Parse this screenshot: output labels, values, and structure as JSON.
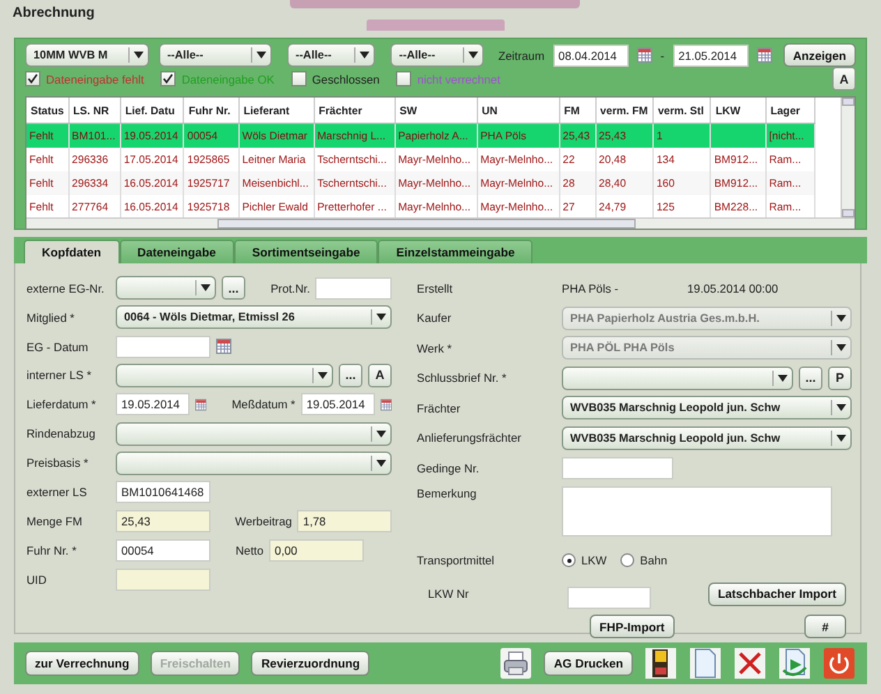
{
  "window": {
    "title": "Abrechnung"
  },
  "filters": {
    "combos": [
      {
        "value": "10MM WVB M"
      },
      {
        "value": "--Alle--"
      },
      {
        "value": "--Alle--"
      },
      {
        "value": "--Alle--"
      }
    ],
    "period_label": "Zeitraum",
    "from": "08.04.2014",
    "separator": "-",
    "to": "21.05.2014",
    "show_button": "Anzeigen",
    "a_button": "A",
    "checkboxes": [
      {
        "label": "Dateneingabe fehlt",
        "checked": true,
        "color": "#c03030"
      },
      {
        "label": "Dateneingabe OK",
        "checked": true,
        "color": "#20a020"
      },
      {
        "label": "Geschlossen",
        "checked": false,
        "color": "#202020"
      },
      {
        "label": "nicht verrechnet",
        "checked": false,
        "color": "#a050d0"
      }
    ]
  },
  "table": {
    "columns": [
      "Status",
      "LS. NR",
      "Lief. Datu",
      "Fuhr Nr.",
      "Lieferant",
      "Frächter",
      "SW",
      "UN",
      "FM",
      "verm. FM",
      "verm. Stl",
      "LKW",
      "Lager"
    ],
    "rows": [
      {
        "selected": true,
        "cells": [
          "Fehlt",
          "BM101...",
          "19.05.2014",
          "00054",
          "Wöls Dietmar",
          "Marschnig L...",
          "Papierholz A...",
          "PHA Pöls",
          "25,43",
          "25,43",
          "1",
          "",
          "[nicht..."
        ]
      },
      {
        "selected": false,
        "cells": [
          "Fehlt",
          "296336",
          "17.05.2014",
          "1925865",
          "Leitner Maria",
          "Tscherntschi...",
          "Mayr-Melnho...",
          "Mayr-Melnho...",
          "22",
          "20,48",
          "134",
          "BM912...",
          "Ram..."
        ]
      },
      {
        "selected": false,
        "cells": [
          "Fehlt",
          "296334",
          "16.05.2014",
          "1925717",
          "Meisenbichl...",
          "Tscherntschi...",
          "Mayr-Melnho...",
          "Mayr-Melnho...",
          "28",
          "28,40",
          "160",
          "BM912...",
          "Ram..."
        ]
      },
      {
        "selected": false,
        "cells": [
          "Fehlt",
          "277764",
          "16.05.2014",
          "1925718",
          "Pichler Ewald",
          "Pretterhofer ...",
          "Mayr-Melnho...",
          "Mayr-Melnho...",
          "27",
          "24,79",
          "125",
          "BM228...",
          "Ram..."
        ]
      }
    ]
  },
  "tabs": [
    {
      "label": "Kopfdaten",
      "selected": true
    },
    {
      "label": "Dateneingabe",
      "selected": false
    },
    {
      "label": "Sortimentseingabe",
      "selected": false
    },
    {
      "label": "Einzelstammeingabe",
      "selected": false
    }
  ],
  "form": {
    "left": [
      {
        "label": "externe EG-Nr.",
        "items": [
          {
            "kind": "combo-short",
            "disabled": false
          },
          {
            "kind": "button",
            "text": "..."
          },
          {
            "kind": "label",
            "text": "Prot.Nr."
          },
          {
            "kind": "text"
          }
        ]
      },
      {
        "label": "Mitglied *",
        "items": [
          {
            "kind": "combo",
            "value": "0064 - Wöls Dietmar, Etmissl 26",
            "disabled": false
          }
        ]
      },
      {
        "label": "EG - Datum",
        "items": [
          {
            "kind": "date"
          }
        ]
      },
      {
        "label": "interner LS *",
        "items": [
          {
            "kind": "combo",
            "disabled": false
          },
          {
            "kind": "button",
            "text": "..."
          },
          {
            "kind": "button",
            "text": "A"
          }
        ]
      },
      {
        "label": "Lieferdatum *",
        "items": [
          {
            "kind": "date",
            "value": "19.05.2014"
          },
          {
            "kind": "label",
            "text": "Meßdatum *"
          },
          {
            "kind": "date",
            "value": "19.05.2014"
          }
        ]
      },
      {
        "label": "Rindenabzug",
        "items": [
          {
            "kind": "combo",
            "disabled": false
          }
        ]
      },
      {
        "label": "Preisbasis *",
        "items": [
          {
            "kind": "combo",
            "disabled": false
          }
        ]
      },
      {
        "label": "externer LS",
        "items": [
          {
            "kind": "text",
            "value": "BM1010641468"
          }
        ]
      },
      {
        "label": "Menge FM",
        "items": [
          {
            "kind": "readonly",
            "value": "25,43"
          },
          {
            "kind": "label",
            "text": "Werbeitrag"
          },
          {
            "kind": "readonly",
            "value": "1,78"
          }
        ]
      },
      {
        "label": "Fuhr Nr. *",
        "items": [
          {
            "kind": "text",
            "value": "00054"
          },
          {
            "kind": "label",
            "text": "Netto"
          },
          {
            "kind": "readonly",
            "value": "0,00"
          }
        ]
      },
      {
        "label": "UID",
        "items": [
          {
            "kind": "readonly"
          }
        ]
      }
    ],
    "right": [
      {
        "label": "Erstellt",
        "items": [
          {
            "kind": "static",
            "text": "PHA Pöls -"
          },
          {
            "kind": "static",
            "text": "19.05.2014 00:00"
          }
        ]
      },
      {
        "label": "Kaufer",
        "items": [
          {
            "kind": "combo",
            "value": "PHA Papierholz Austria Ges.m.b.H.",
            "disabled": true
          }
        ]
      },
      {
        "label": "Werk *",
        "items": [
          {
            "kind": "combo",
            "value": "PHA PÖL PHA Pöls",
            "disabled": true
          }
        ]
      },
      {
        "label": "Schlussbrief Nr. *",
        "items": [
          {
            "kind": "combo",
            "disabled": false
          },
          {
            "kind": "button",
            "text": "..."
          },
          {
            "kind": "button",
            "text": "P"
          }
        ]
      },
      {
        "label": "Frächter",
        "items": [
          {
            "kind": "combo",
            "value": "WVB035 Marschnig Leopold jun. Schw",
            "disabled": false
          }
        ]
      },
      {
        "label": "Anlieferungsfrächter",
        "items": [
          {
            "kind": "combo",
            "value": "WVB035 Marschnig Leopold jun. Schw",
            "disabled": false
          }
        ]
      },
      {
        "label": "Gedinge Nr.",
        "items": [
          {
            "kind": "text"
          }
        ]
      },
      {
        "label": "Bemerkung",
        "items": [
          {
            "kind": "memo"
          }
        ]
      },
      {
        "label": "Transportmittel",
        "items": [
          {
            "kind": "radio",
            "text": "LKW",
            "selected": true
          },
          {
            "kind": "radio",
            "text": "Bahn",
            "selected": false
          }
        ]
      }
    ],
    "lkw_label": "LKW Nr",
    "latschbacher_button": "Latschbacher Import",
    "fhp_button": "FHP-Import",
    "hash_button": "#"
  },
  "bottom_bar": {
    "buttons": [
      {
        "label": "zur Verrechnung",
        "disabled": false
      },
      {
        "label": "Freischalten",
        "disabled": true
      },
      {
        "label": "Revierzuordnung",
        "disabled": false
      }
    ],
    "print_button": "AG Drucken"
  }
}
